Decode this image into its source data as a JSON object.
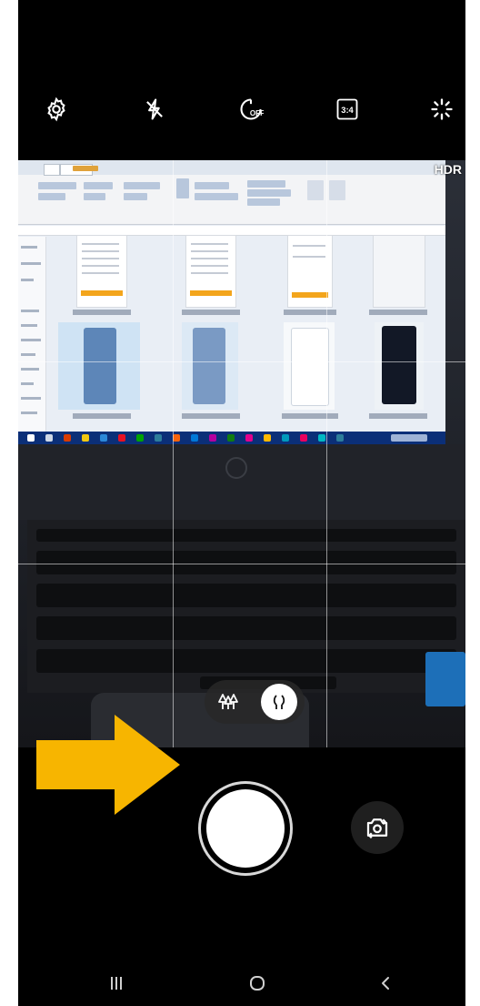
{
  "top_controls": [
    {
      "name": "settings",
      "icon": "gear-icon"
    },
    {
      "name": "flash",
      "icon": "flash-off-icon"
    },
    {
      "name": "timer",
      "icon": "timer-off-icon",
      "label": "OFF"
    },
    {
      "name": "ratio",
      "icon": "aspect-ratio-icon",
      "label": "3:4"
    },
    {
      "name": "effects",
      "icon": "sparkle-icon"
    }
  ],
  "hdr_label": "HDR",
  "focus_modes": [
    {
      "name": "landscape",
      "icon": "trees-icon",
      "selected": false
    },
    {
      "name": "single",
      "icon": "tree-icon",
      "selected": true
    }
  ],
  "shutter": {
    "icon": "shutter-icon"
  },
  "flip_camera": {
    "icon": "flip-camera-icon"
  },
  "nav_bar": [
    {
      "name": "recents",
      "icon": "recents-icon"
    },
    {
      "name": "home",
      "icon": "home-icon"
    },
    {
      "name": "back",
      "icon": "back-icon"
    }
  ],
  "annotation": {
    "icon": "arrow-right-icon",
    "color": "#F7B500"
  }
}
